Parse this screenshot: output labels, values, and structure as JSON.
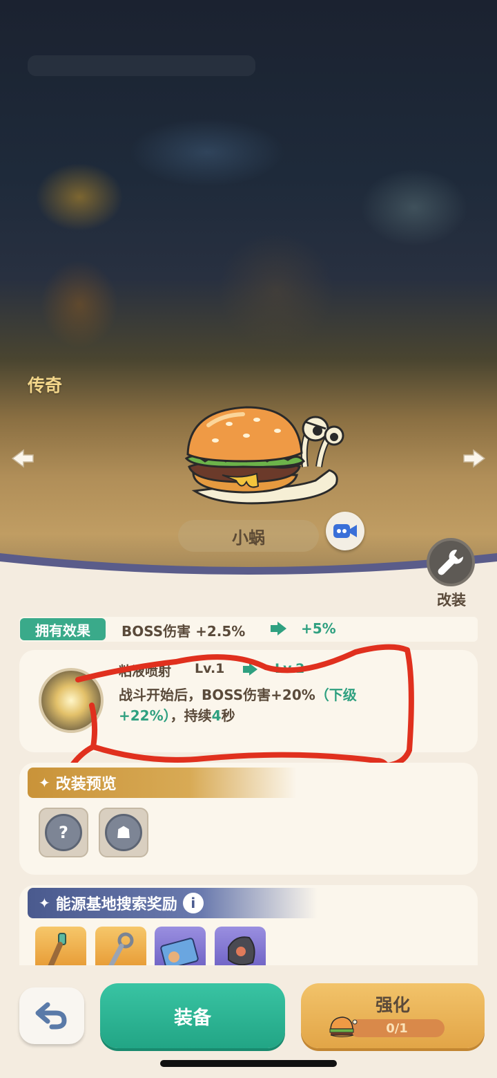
{
  "header": {
    "rarity": "传奇"
  },
  "pet": {
    "name": "小蜗"
  },
  "modify": {
    "label": "改装"
  },
  "effect": {
    "tag": "拥有效果",
    "current": "BOSS伤害 +2.5%",
    "next": "+5%"
  },
  "skill": {
    "name": "粘液喷射",
    "level_current": "Lv.1",
    "level_next": "Lv.2",
    "desc_main": "战斗开始后，BOSS伤害+20%",
    "desc_next": "（下级+22%）",
    "desc_tail": "，持续",
    "duration_value": "4",
    "duration_unit": "秒"
  },
  "preview": {
    "title": "改装预览",
    "chips": [
      {
        "icon": "question-chip-icon",
        "glyph": "?"
      },
      {
        "icon": "robot-chip-icon",
        "glyph": "☗"
      }
    ]
  },
  "rewards": {
    "title": "能源基地搜索奖励",
    "info": "i",
    "items": [
      {
        "icon": "green-key-icon"
      },
      {
        "icon": "silver-key-icon"
      },
      {
        "icon": "card-ticket-icon"
      },
      {
        "icon": "dark-gem-icon"
      }
    ]
  },
  "actions": {
    "back_icon": "back-arrow-icon",
    "equip": "装备",
    "enhance": "强化",
    "enhance_progress": "0/1"
  },
  "colors": {
    "accent_green": "#2fa080",
    "gold": "#d8aa55",
    "purple_header": "#4a5a8e"
  }
}
